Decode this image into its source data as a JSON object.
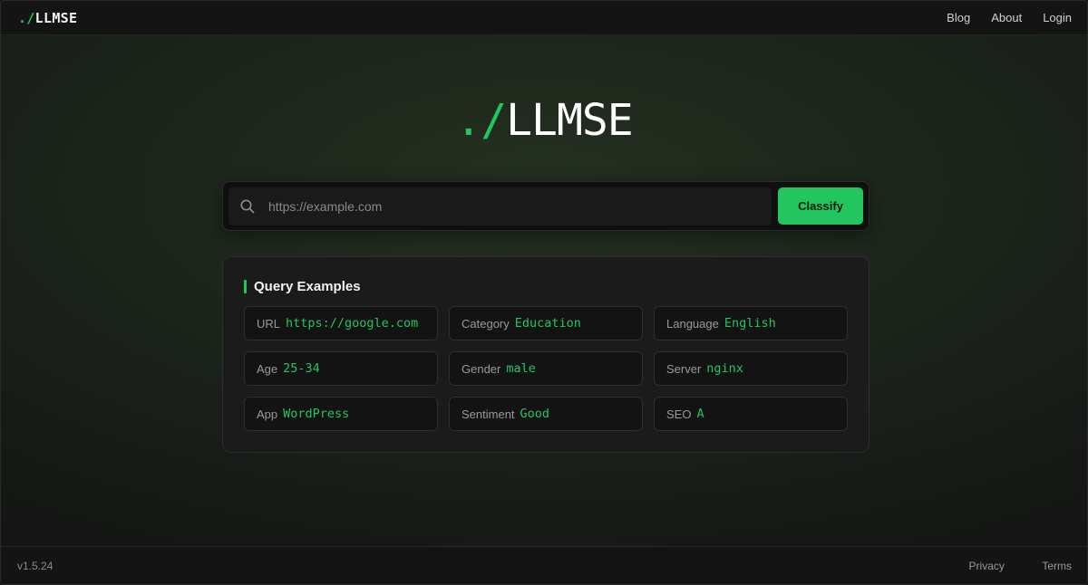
{
  "header": {
    "brand_prefix": "./",
    "brand_name": "LLMSE",
    "nav": [
      {
        "label": "Blog"
      },
      {
        "label": "About"
      },
      {
        "label": "Login"
      }
    ]
  },
  "hero": {
    "logo_prefix": "./",
    "logo_name": "LLMSE"
  },
  "search": {
    "icon": "search-icon",
    "placeholder": "https://example.com",
    "value": "",
    "button_label": "Classify"
  },
  "examples": {
    "title": "Query Examples",
    "items": [
      {
        "key": "URL",
        "value": "https://google.com"
      },
      {
        "key": "Category",
        "value": "Education"
      },
      {
        "key": "Language",
        "value": "English"
      },
      {
        "key": "Age",
        "value": "25-34"
      },
      {
        "key": "Gender",
        "value": "male"
      },
      {
        "key": "Server",
        "value": "nginx"
      },
      {
        "key": "App",
        "value": "WordPress"
      },
      {
        "key": "Sentiment",
        "value": "Good"
      },
      {
        "key": "SEO",
        "value": "A"
      }
    ]
  },
  "footer": {
    "version": "v1.5.24",
    "links": [
      {
        "label": "Privacy"
      },
      {
        "label": "Terms"
      }
    ]
  },
  "colors": {
    "accent": "#22c55e",
    "background": "#1c241b",
    "surface": "#1b1b1b"
  }
}
